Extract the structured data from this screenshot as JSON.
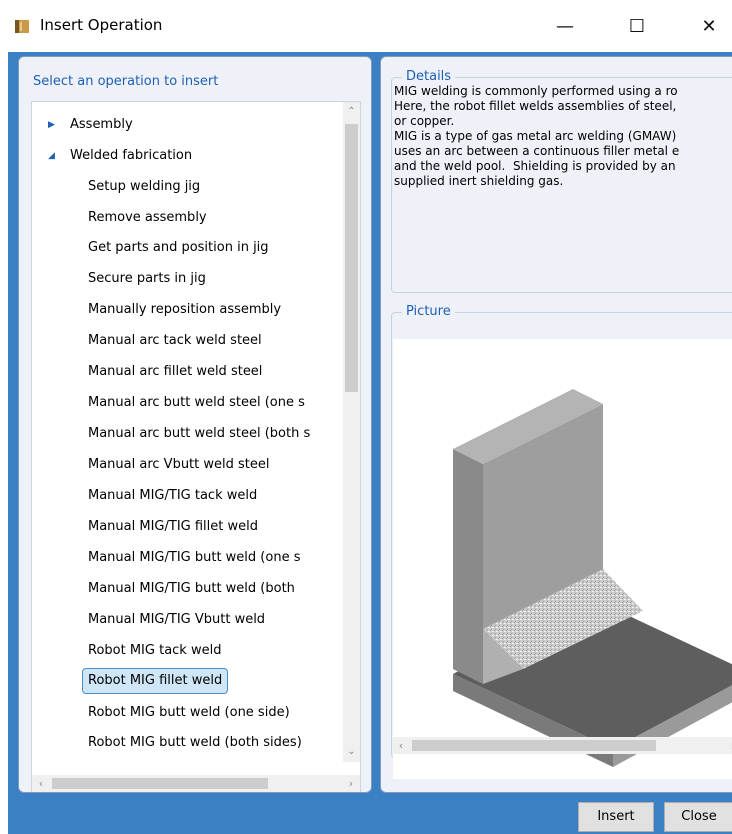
{
  "window": {
    "title": "Insert Operation",
    "minimize_glyph": "—",
    "maximize_glyph": "☐",
    "close_glyph": "✕"
  },
  "left": {
    "heading": "Select an operation to insert",
    "groups": [
      {
        "label": "Assembly",
        "expanded": false
      },
      {
        "label": "Welded fabrication",
        "expanded": true
      }
    ],
    "items": [
      "Setup welding jig",
      "Remove assembly",
      "Get parts and position in jig",
      "Secure parts in jig",
      "Manually reposition assembly",
      "Manual arc tack weld steel",
      "Manual arc fillet weld steel",
      "Manual arc butt weld steel (one s",
      "Manual arc butt weld steel (both s",
      "Manual arc Vbutt weld steel",
      "Manual MIG/TIG tack weld",
      "Manual MIG/TIG fillet weld",
      "Manual MIG/TIG butt weld (one s",
      "Manual MIG/TIG butt weld (both",
      "Manual MIG/TIG Vbutt weld",
      "Robot MIG tack weld",
      "Robot MIG fillet weld",
      "Robot MIG butt weld (one side)",
      "Robot MIG butt weld (both sides)"
    ],
    "selected_item": "Robot MIG fillet weld"
  },
  "details": {
    "label": "Details",
    "text": "MIG welding is commonly performed using a ro\nHere, the robot fillet welds assemblies of steel,\nor copper.\nMIG is a type of gas metal arc welding (GMAW)\nuses an arc between a continuous filler metal e\nand the weld pool.  Shielding is provided by an\nsupplied inert shielding gas."
  },
  "picture": {
    "label": "Picture"
  },
  "buttons": {
    "insert": "Insert",
    "close": "Close"
  },
  "colors": {
    "accent": "#1e5fb3",
    "background": "#3b7fc4",
    "selection": "#cfe6f7"
  }
}
